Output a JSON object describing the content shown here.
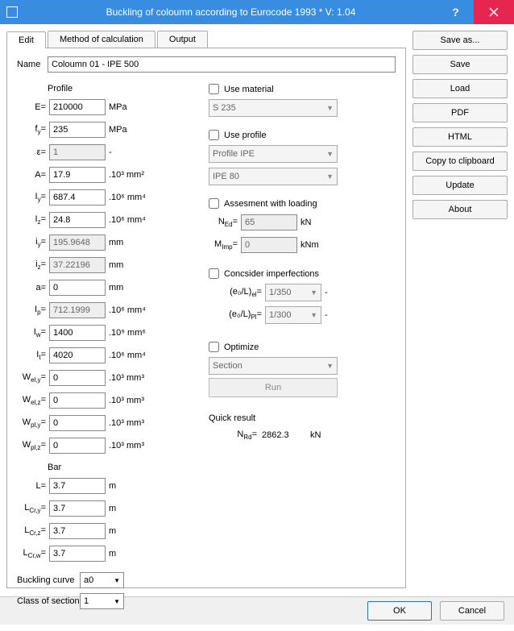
{
  "window": {
    "title": "Buckling of coloumn according to Eurocode 1993 * V: 1.04"
  },
  "tabs": {
    "edit": "Edit",
    "method": "Method of calculation",
    "output": "Output"
  },
  "name": {
    "label": "Name",
    "value": "Coloumn 01 - IPE 500"
  },
  "profile": {
    "title": "Profile",
    "E": {
      "label": "E=",
      "value": "210000",
      "unit": "MPa"
    },
    "fy": {
      "label": "f",
      "sub": "y",
      "value": "235",
      "unit": "MPa"
    },
    "eps": {
      "label": "ε=",
      "value": "1",
      "unit": "-"
    },
    "A": {
      "label": "A=",
      "value": "17.9",
      "unit": ".10³ mm²"
    },
    "Iy": {
      "label": "I",
      "sub": "y",
      "value": "687.4",
      "unit": ".10⁶ mm⁴"
    },
    "Iz": {
      "label": "I",
      "sub": "z",
      "value": "24.8",
      "unit": ".10⁶ mm⁴"
    },
    "iy": {
      "label": "i",
      "sub": "y",
      "value": "195.9648",
      "unit": "mm"
    },
    "iz": {
      "label": "i",
      "sub": "z",
      "value": "37.22196",
      "unit": "mm"
    },
    "a": {
      "label": "a=",
      "value": "0",
      "unit": "mm"
    },
    "Ip": {
      "label": "I",
      "sub": "p",
      "value": "712.1999",
      "unit": ".10⁶ mm⁴"
    },
    "Iw": {
      "label": "I",
      "sub": "w",
      "value": "1400",
      "unit": ".10⁹ mm⁶"
    },
    "It": {
      "label": "I",
      "sub": "t",
      "value": "4020",
      "unit": ".10⁶ mm⁴"
    },
    "Wely": {
      "label": "W",
      "sub": "el,y",
      "value": "0",
      "unit": ".10³ mm³"
    },
    "Welz": {
      "label": "W",
      "sub": "el,z",
      "value": "0",
      "unit": ".10³ mm³"
    },
    "Wply": {
      "label": "W",
      "sub": "pl,y",
      "value": "0",
      "unit": ".10³ mm³"
    },
    "Wplz": {
      "label": "W",
      "sub": "pl,z",
      "value": "0",
      "unit": ".10³ mm³"
    }
  },
  "bar": {
    "title": "Bar",
    "L": {
      "label": "L=",
      "value": "3.7",
      "unit": "m"
    },
    "Lcry": {
      "label": "L",
      "sub": "Cr,y",
      "value": "3.7",
      "unit": "m"
    },
    "Lcrz": {
      "label": "L",
      "sub": "Cr,z",
      "value": "3.7",
      "unit": "m"
    },
    "Lcrw": {
      "label": "L",
      "sub": "Cr,w",
      "value": "3.7",
      "unit": "m"
    }
  },
  "buckling_curve": {
    "label": "Buckling curve",
    "value": "a0"
  },
  "class_of_section": {
    "label": "Class of section",
    "value": "1"
  },
  "use_material": {
    "label": "Use material",
    "value": "S 235"
  },
  "use_profile": {
    "label": "Use profile",
    "profile": "Profile IPE",
    "section": "IPE 80"
  },
  "assessment": {
    "label": "Assesment with loading",
    "NEd": {
      "label": "N",
      "sub": "Ed",
      "value": "65",
      "unit": "kN"
    },
    "MImp": {
      "label": "M",
      "sub": "Imp",
      "value": "0",
      "unit": "kNm"
    }
  },
  "imperfections": {
    "label": "Concsider imperfections",
    "eoLel": {
      "label": "(e₀/L)",
      "sub": "el",
      "value": "1/350",
      "unit": "-"
    },
    "eoLpl": {
      "label": "(e₀/L)",
      "sub": "Pl",
      "value": "1/300",
      "unit": "-"
    }
  },
  "optimize": {
    "label": "Optimize",
    "value": "Section",
    "run": "Run"
  },
  "quick": {
    "title": "Quick result",
    "NRd": {
      "label": "N",
      "sub": "Rd",
      "value": "2862.3",
      "unit": "kN"
    }
  },
  "buttons": {
    "saveas": "Save as...",
    "save": "Save",
    "load": "Load",
    "pdf": "PDF",
    "html": "HTML",
    "copy": "Copy to clipboard",
    "update": "Update",
    "about": "About",
    "ok": "OK",
    "cancel": "Cancel"
  }
}
